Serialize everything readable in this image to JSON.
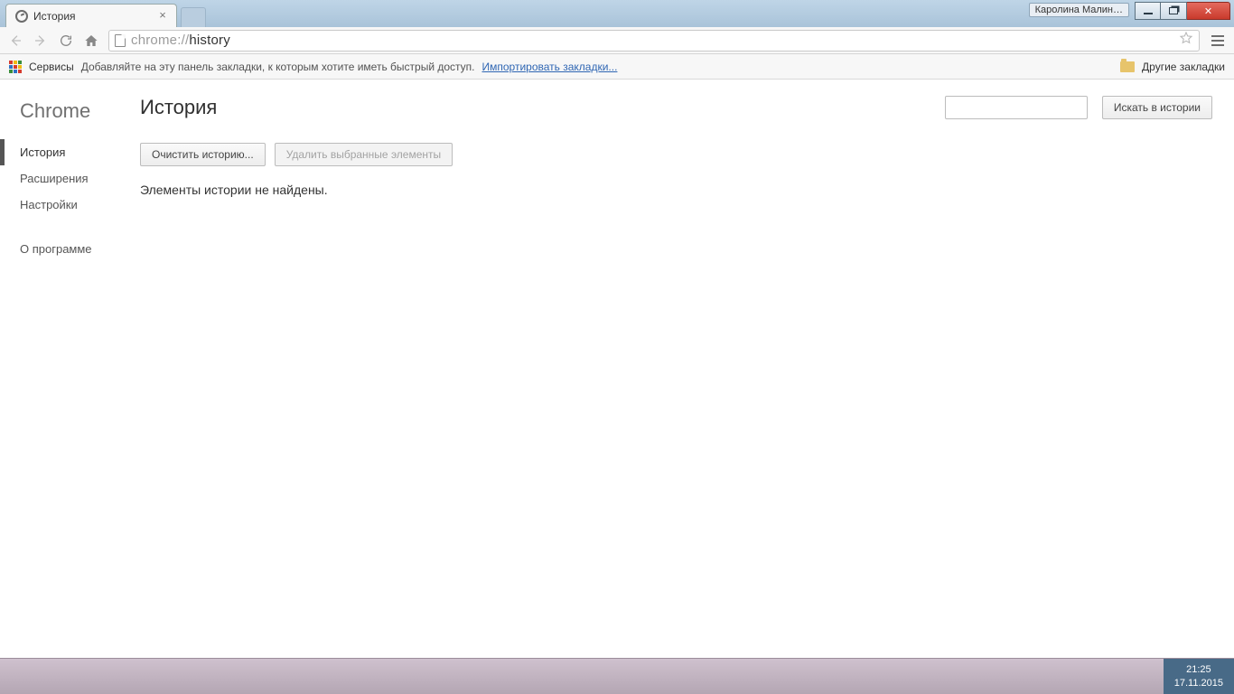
{
  "window": {
    "user_label": "Каролина Малин…"
  },
  "tab": {
    "title": "История"
  },
  "omnibox": {
    "scheme": "chrome://",
    "path": "history"
  },
  "bookbar": {
    "apps_label": "Сервисы",
    "hint": "Добавляйте на эту панель закладки, к которым хотите иметь быстрый доступ.",
    "import_link": "Импортировать закладки...",
    "other_bookmarks": "Другие закладки"
  },
  "sidebar": {
    "brand": "Chrome",
    "items": [
      "История",
      "Расширения",
      "Настройки"
    ],
    "about": "О программе"
  },
  "main": {
    "title": "История",
    "search_button": "Искать в истории",
    "clear_button": "Очистить историю...",
    "delete_button": "Удалить выбранные элементы",
    "empty_message": "Элементы истории не найдены."
  },
  "taskbar": {
    "time": "21:25",
    "date": "17.11.2015"
  }
}
